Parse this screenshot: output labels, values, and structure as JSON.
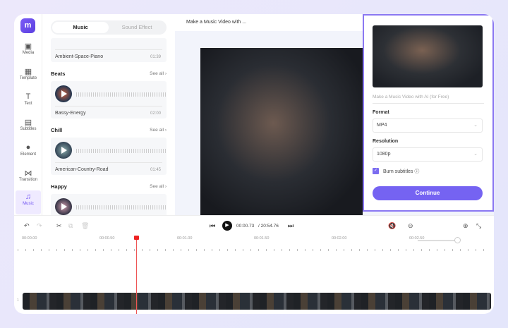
{
  "sidebar": {
    "items": [
      {
        "label": "Media",
        "icon": "media-icon"
      },
      {
        "label": "Template",
        "icon": "template-icon"
      },
      {
        "label": "Text",
        "icon": "text-icon"
      },
      {
        "label": "Subtitles",
        "icon": "subtitles-icon"
      },
      {
        "label": "Element",
        "icon": "element-icon"
      },
      {
        "label": "Transition",
        "icon": "transition-icon"
      },
      {
        "label": "Music",
        "icon": "music-icon",
        "active": true
      }
    ]
  },
  "panel": {
    "tabs": [
      "Music",
      "Sound Effect"
    ],
    "see_all": "See all ›",
    "tracks": [
      {
        "name": "Ambient-Space-Piano",
        "duration": "01:39"
      },
      {
        "category": "Beats",
        "name": "Bassy-Energy",
        "duration": "02:00"
      },
      {
        "category": "Chill",
        "name": "American-Country-Road",
        "duration": "01:45"
      },
      {
        "category": "Happy"
      }
    ]
  },
  "preview": {
    "title": "Make a Music Video with ..."
  },
  "export": {
    "project_name_placeholder": "Make a Music Video with AI (for Free)",
    "format_label": "Format",
    "format_value": "MP4",
    "resolution_label": "Resolution",
    "resolution_value": "1080p",
    "burn_subtitles_label": "Burn subtitles",
    "burn_subtitles_checked": true,
    "continue_label": "Continue",
    "accent": "#7563f2"
  },
  "timeline": {
    "current_time": "00:00.73",
    "total_time": "/ 20:54.76",
    "ruler": [
      "00:00.00",
      "00:00.50",
      "00:01.00",
      "00:01.50",
      "00:02.00",
      "00:02.50"
    ],
    "zoom_level": 1.0,
    "track_number": "1"
  }
}
